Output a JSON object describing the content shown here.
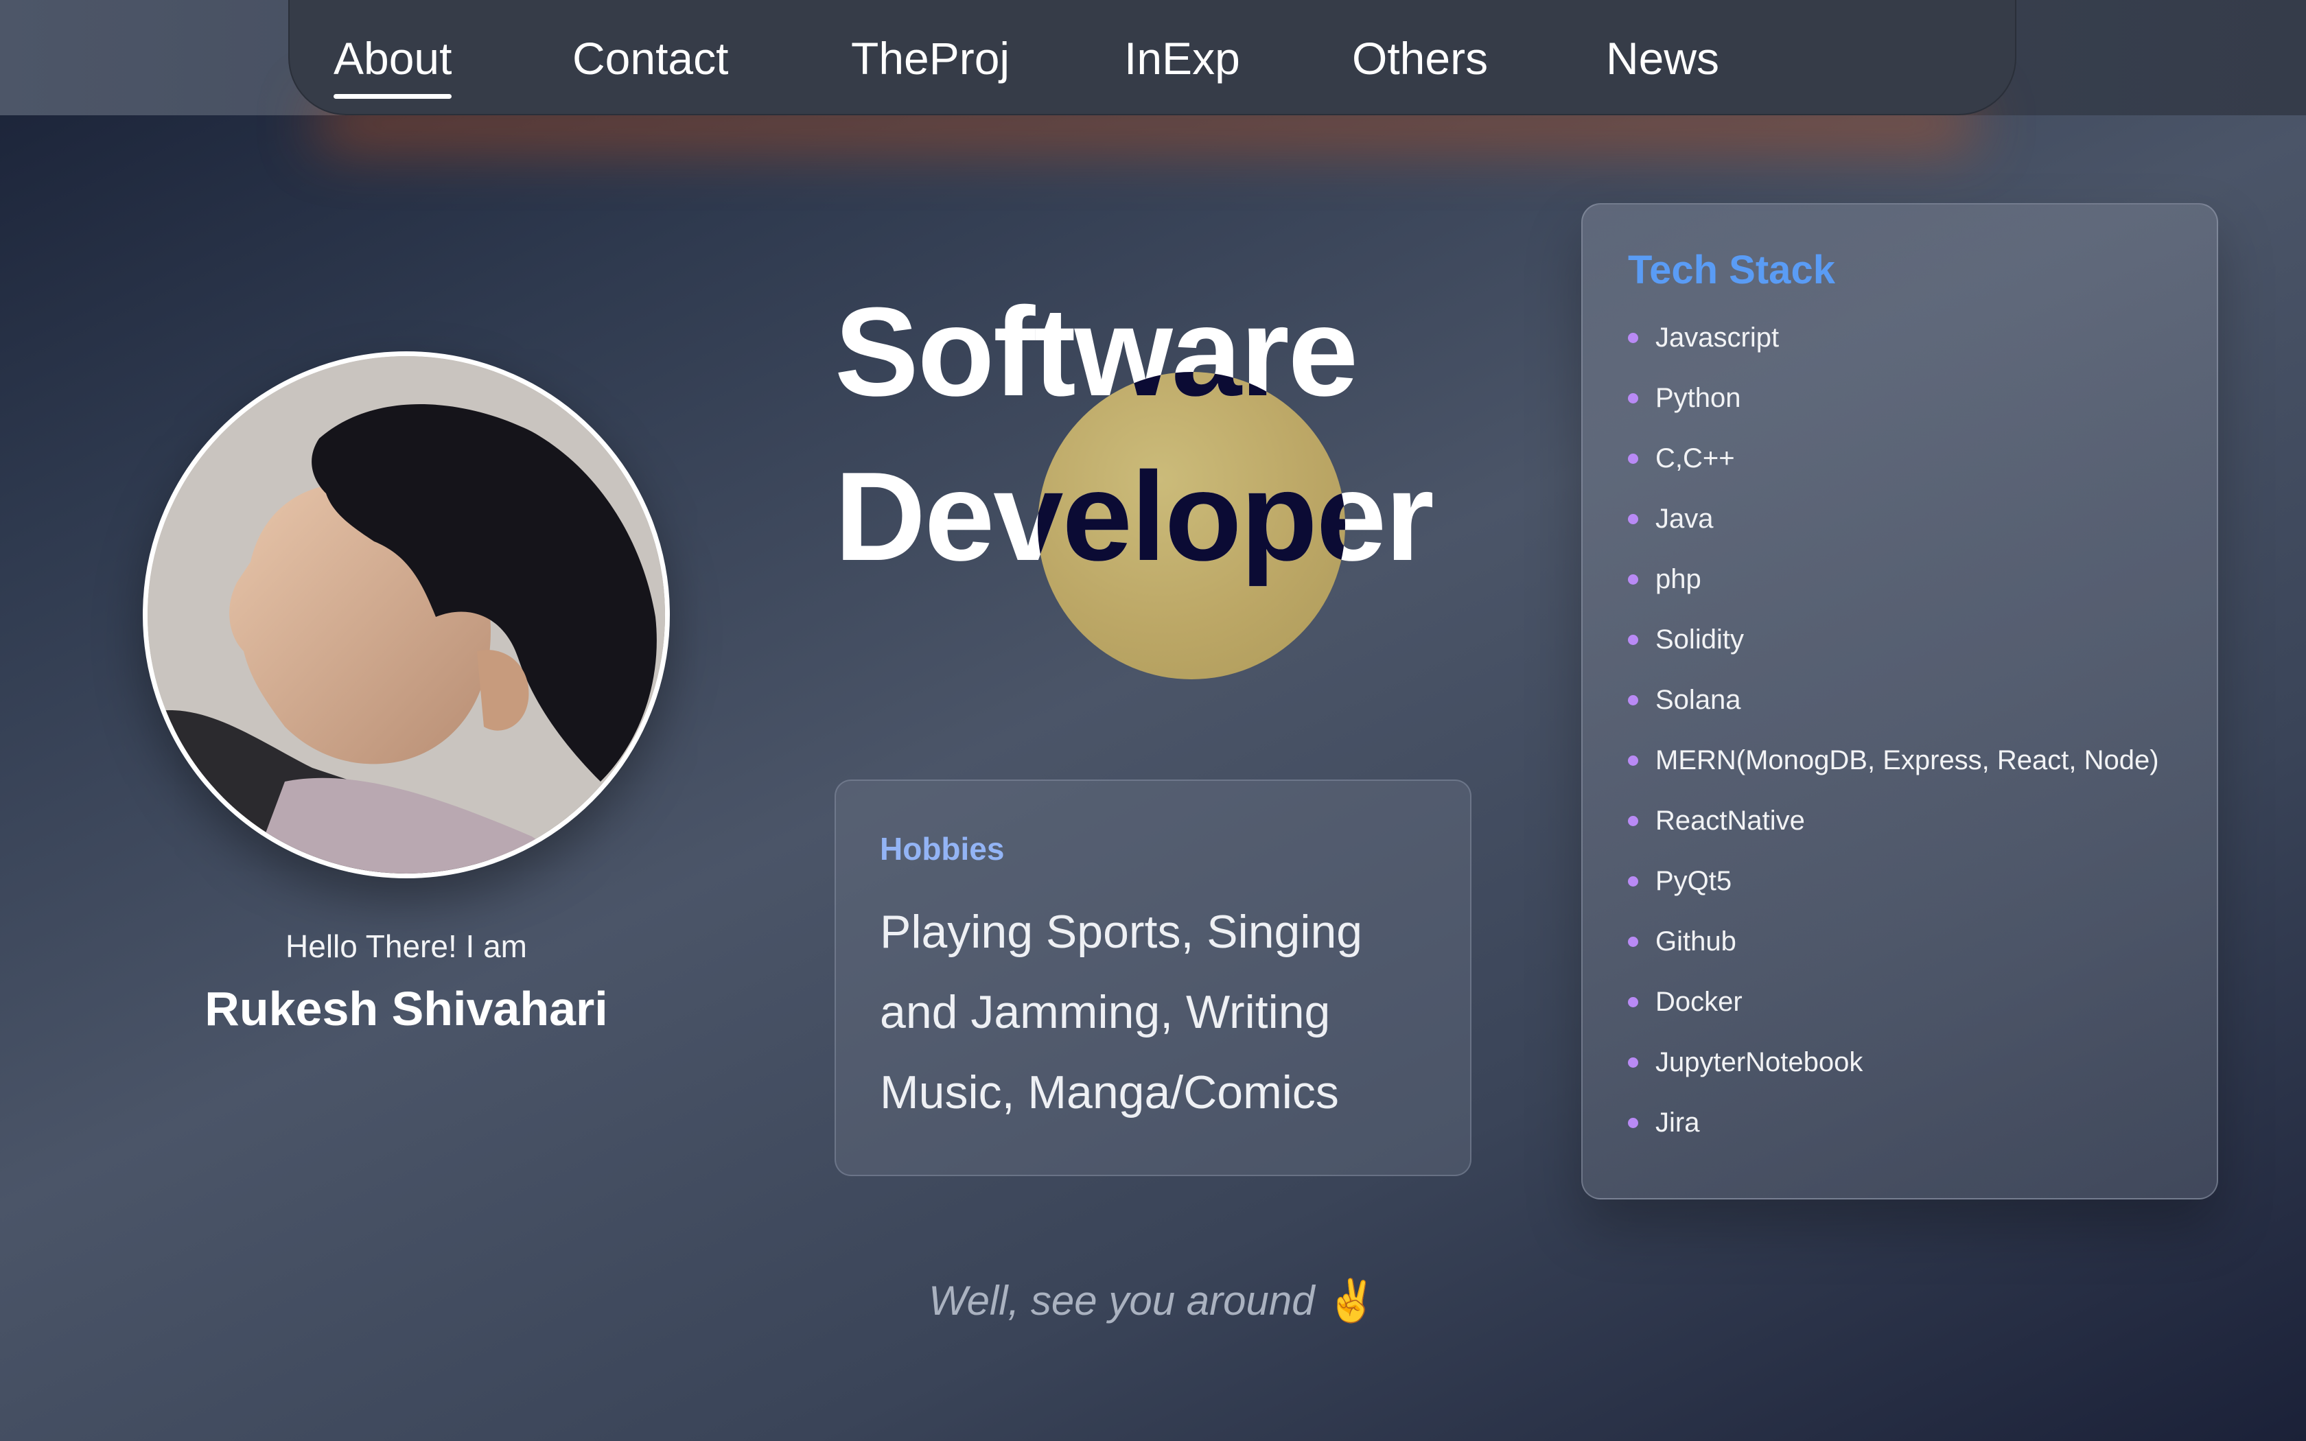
{
  "nav": {
    "items": [
      {
        "label": "About",
        "active": true
      },
      {
        "label": "Contact"
      },
      {
        "label": "TheProj"
      },
      {
        "label": "InExp"
      },
      {
        "label": "Others"
      },
      {
        "label": "News"
      }
    ]
  },
  "profile": {
    "greeting": "Hello There! I am",
    "name": "Rukesh Shivahari"
  },
  "hero": {
    "line1": "Software",
    "line2": "Developer",
    "circle_color": "#bca766",
    "overlay_text_color": "#0b0b34"
  },
  "hobbies": {
    "title": "Hobbies",
    "text": "Playing Sports, Singing and Jamming, Writing Music, Manga/Comics"
  },
  "tech_stack": {
    "title": "Tech Stack",
    "items": [
      "Javascript",
      "Python",
      "C,C++",
      "Java",
      "php",
      "Solidity",
      "Solana",
      "MERN(MonogDB, Express, React, Node)",
      "ReactNative",
      "PyQt5",
      "Github",
      "Docker",
      "JupyterNotebook",
      "Jira"
    ]
  },
  "footer": {
    "text": "Well, see you around",
    "emoji": "✌️"
  },
  "colors": {
    "accent_blue": "#5a9cf5",
    "hobbies_title": "#93b4f5",
    "bullet": "#b98af5",
    "nav_glow": "#cd551e"
  }
}
